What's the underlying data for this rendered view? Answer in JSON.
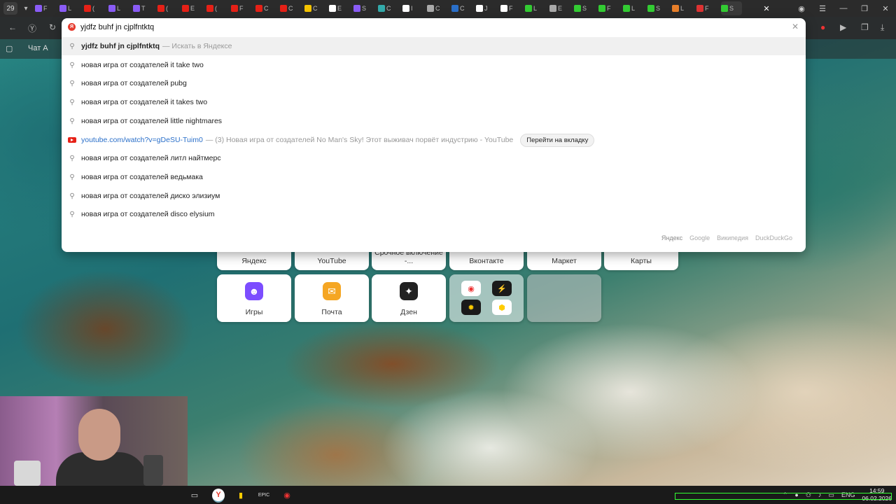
{
  "tabstrip": {
    "tab_count": "29",
    "tabs": [
      {
        "label": "F",
        "color": "#8a5cf6"
      },
      {
        "label": "L",
        "color": "#8a5cf6"
      },
      {
        "label": "(",
        "color": "#e62117"
      },
      {
        "label": "L",
        "color": "#8a5cf6"
      },
      {
        "label": "T",
        "color": "#8a5cf6"
      },
      {
        "label": "(",
        "color": "#e62117"
      },
      {
        "label": "E",
        "color": "#e62117"
      },
      {
        "label": "(",
        "color": "#e62117"
      },
      {
        "label": "F",
        "color": "#e62117"
      },
      {
        "label": "C",
        "color": "#e62117"
      },
      {
        "label": "C",
        "color": "#e62117"
      },
      {
        "label": "C",
        "color": "#f5c400"
      },
      {
        "label": "E",
        "color": "#ffffff"
      },
      {
        "label": "S",
        "color": "#8a5cf6"
      },
      {
        "label": "C",
        "color": "#3aa"
      },
      {
        "label": "I",
        "color": "#ffffff"
      },
      {
        "label": "C",
        "color": "#aaaaaa"
      },
      {
        "label": "C",
        "color": "#2a6fc9"
      },
      {
        "label": "J",
        "color": "#ffffff"
      },
      {
        "label": "F",
        "color": "#ffffff"
      },
      {
        "label": "L",
        "color": "#3c3"
      },
      {
        "label": "E",
        "color": "#aaaaaa"
      },
      {
        "label": "S",
        "color": "#3c3"
      },
      {
        "label": "F",
        "color": "#3c3"
      },
      {
        "label": "L",
        "color": "#3c3"
      },
      {
        "label": "S",
        "color": "#3c3"
      },
      {
        "label": "L",
        "color": "#e87f2a"
      },
      {
        "label": "F",
        "color": "#d33"
      },
      {
        "label": "S",
        "color": "#3c3"
      }
    ],
    "window_controls": [
      "☰",
      "—",
      "❐",
      "✕"
    ]
  },
  "bookmarks": {
    "item1": "▢",
    "item2": "Чат А"
  },
  "omnibox": {
    "query": "yjdfz buhf jn cjplfntktq",
    "clear_icon": "✕",
    "first": {
      "text": "yjdfz buhf jn cjplfntktq",
      "hint": "— Искать в Яндексе"
    },
    "suggestions_top": [
      "новая игра от создателей it take two",
      "новая игра от создателей pubg",
      "новая игра от создателей it takes two",
      "новая игра от создателей little nightmares"
    ],
    "youtube": {
      "url": "youtube.com/watch?v=gDeSU-Tuim0",
      "title": "— (3) Новая игра от создателей No Man's Sky! Этот выживач порвёт индустрию - YouTube",
      "tab_button": "Перейти на вкладку"
    },
    "suggestions_bottom": [
      "новая игра от создателей литл найтмерс",
      "новая игра от создателей ведьмака",
      "новая игра от создателей диско элизиум",
      "новая игра от создателей disco elysium"
    ],
    "engines": [
      "Яндекс",
      "Google",
      "Википедия",
      "DuckDuckGo"
    ]
  },
  "tableau": {
    "row1": [
      "Яндекс",
      "YouTube",
      "Срочное включение -...",
      "Вконтакте",
      "Маркет",
      "Карты"
    ],
    "row2": [
      {
        "label": "Игры",
        "color": "#7c4dff",
        "icon": "gamepad-icon",
        "glyph": "☻"
      },
      {
        "label": "Почта",
        "color": "#f5a623",
        "icon": "mail-icon",
        "glyph": "✉"
      },
      {
        "label": "Дзен",
        "color": "#222222",
        "icon": "zen-icon",
        "glyph": "✦"
      }
    ]
  },
  "taskbar": {
    "tray_lang": "ENG",
    "time": "14:59",
    "date": "06.02.2026"
  }
}
